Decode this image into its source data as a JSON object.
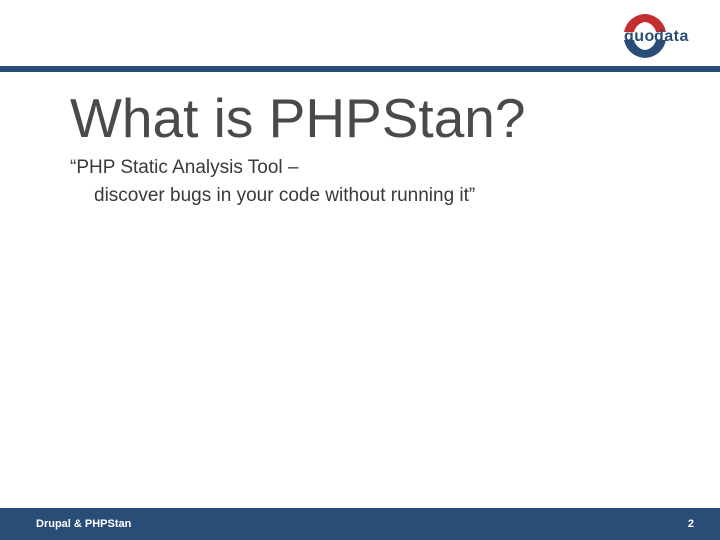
{
  "logo": {
    "text_left": "quo",
    "text_right": "data"
  },
  "slide": {
    "title": "What is PHPStan?",
    "subtitle_line1": "“PHP Static Analysis Tool –",
    "subtitle_line2": "discover bugs in your code without running it”"
  },
  "footer": {
    "left": "Drupal & PHPStan",
    "page_number": "2"
  }
}
